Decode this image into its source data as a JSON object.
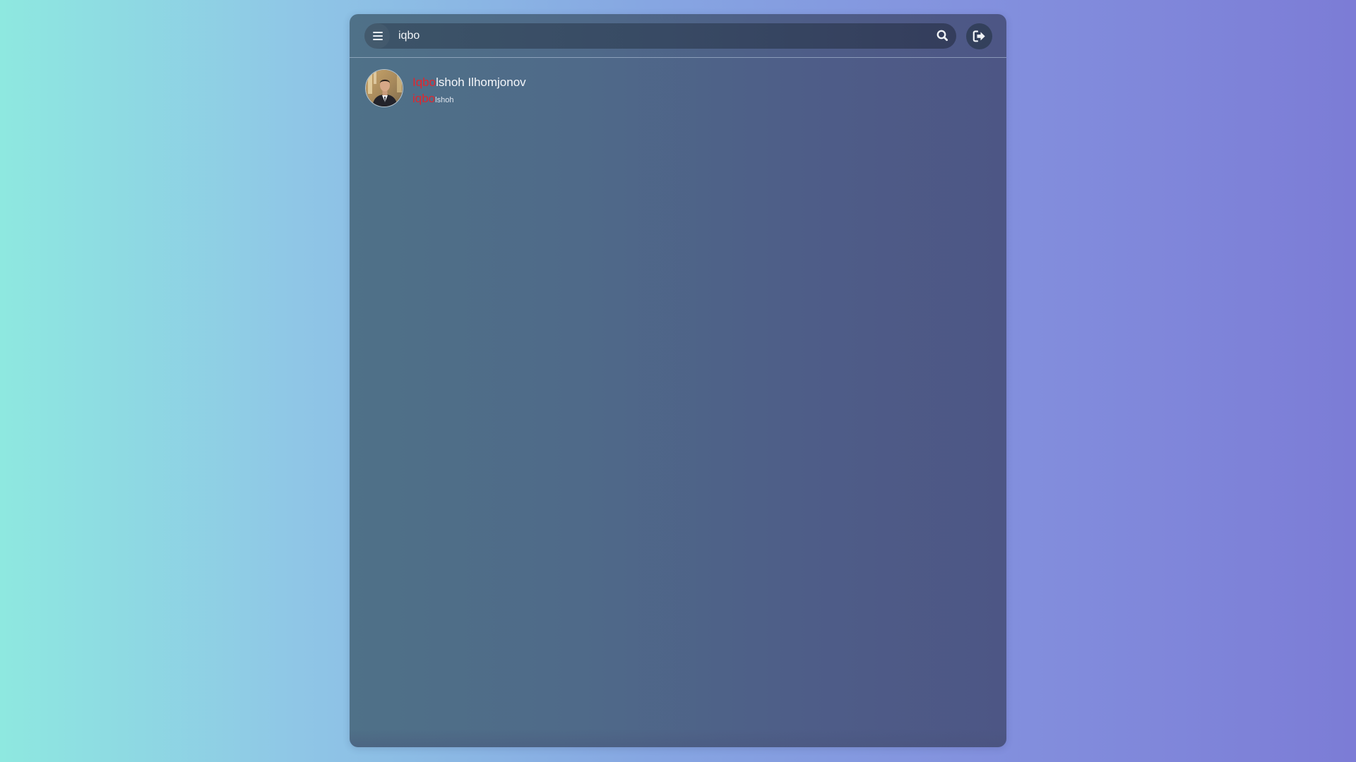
{
  "search": {
    "value": "iqbo",
    "menu_icon": "hamburger-menu-icon",
    "search_icon": "magnifier-icon",
    "logout_icon": "sign-out-icon"
  },
  "results": [
    {
      "name_match": "Iqbo",
      "name_rest": "lshoh Ilhomjonov",
      "username_match": "iqbo",
      "username_rest": "lshoh",
      "avatar_icon": "user-avatar-photo"
    }
  ],
  "colors": {
    "highlight": "#e0262e",
    "panel": "#4f6a89",
    "search_bar": "#384a64"
  }
}
